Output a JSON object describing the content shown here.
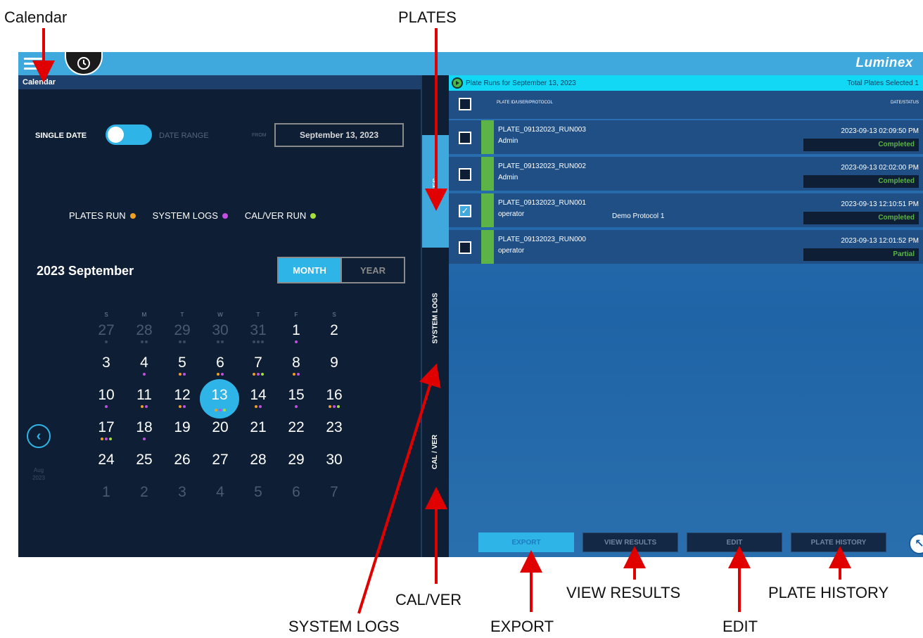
{
  "annotations": {
    "calendar": "Calendar",
    "plates": "PLATES",
    "cal_ver": "CAL/VER",
    "system_logs": "SYSTEM LOGS",
    "export": "EXPORT",
    "view_results": "VIEW RESULTS",
    "edit": "EDIT",
    "plate_history": "PLATE HISTORY"
  },
  "topbar": {
    "brand": "Luminex",
    "menu_icon": "hamburger-icon",
    "history_icon": "history-clock-icon"
  },
  "calendar": {
    "header": "Calendar",
    "single_date_label": "SINGLE DATE",
    "date_range_label": "DATE RANGE",
    "from_label": "FROM",
    "selected_date": "September 13, 2023",
    "legend": [
      {
        "label": "PLATES RUN",
        "color": "#f0a020"
      },
      {
        "label": "SYSTEM LOGS",
        "color": "#c24fe0"
      },
      {
        "label": "CAL/VER RUN",
        "color": "#a6e03a"
      }
    ],
    "month_title": "2023 September",
    "month_button": "MONTH",
    "year_button": "YEAR",
    "weekdays": [
      "S",
      "M",
      "T",
      "W",
      "T",
      "F",
      "S"
    ],
    "prev_label_line1": "Aug",
    "prev_label_line2": "2023",
    "days": [
      {
        "n": "27",
        "m": true,
        "dots": [
          "#3a4a60"
        ]
      },
      {
        "n": "28",
        "m": true,
        "dots": [
          "#3a4a60",
          "#3a4a60"
        ]
      },
      {
        "n": "29",
        "m": true,
        "dots": [
          "#3a4a60",
          "#3a4a60"
        ]
      },
      {
        "n": "30",
        "m": true,
        "dots": [
          "#3a4a60",
          "#3a4a60"
        ]
      },
      {
        "n": "31",
        "m": true,
        "dots": [
          "#3a4a60",
          "#3a4a60",
          "#3a4a60"
        ]
      },
      {
        "n": "1",
        "dots": [
          "#c24fe0"
        ]
      },
      {
        "n": "2",
        "dots": []
      },
      {
        "n": "3",
        "dots": []
      },
      {
        "n": "4",
        "dots": [
          "#c24fe0"
        ]
      },
      {
        "n": "5",
        "dots": [
          "#f0a020",
          "#c24fe0"
        ]
      },
      {
        "n": "6",
        "dots": [
          "#f0a020",
          "#c24fe0"
        ]
      },
      {
        "n": "7",
        "dots": [
          "#f0a020",
          "#c24fe0",
          "#a6e03a"
        ]
      },
      {
        "n": "8",
        "dots": [
          "#f0a020",
          "#c24fe0"
        ]
      },
      {
        "n": "9",
        "dots": []
      },
      {
        "n": "10",
        "dots": [
          "#c24fe0"
        ]
      },
      {
        "n": "11",
        "dots": [
          "#f0a020",
          "#c24fe0"
        ]
      },
      {
        "n": "12",
        "dots": [
          "#f0a020",
          "#c24fe0"
        ]
      },
      {
        "n": "13",
        "sel": true,
        "dots": [
          "#f0a020",
          "#c24fe0",
          "#a6e03a"
        ]
      },
      {
        "n": "14",
        "dots": [
          "#f0a020",
          "#c24fe0"
        ]
      },
      {
        "n": "15",
        "dots": [
          "#c24fe0"
        ]
      },
      {
        "n": "16",
        "dots": [
          "#f0a020",
          "#c24fe0",
          "#a6e03a"
        ]
      },
      {
        "n": "17",
        "dots": [
          "#f0a020",
          "#c24fe0",
          "#a6e03a"
        ]
      },
      {
        "n": "18",
        "dots": [
          "#c24fe0"
        ]
      },
      {
        "n": "19",
        "dots": []
      },
      {
        "n": "20",
        "dots": []
      },
      {
        "n": "21",
        "dots": []
      },
      {
        "n": "22",
        "dots": []
      },
      {
        "n": "23",
        "dots": []
      },
      {
        "n": "24",
        "dots": []
      },
      {
        "n": "25",
        "dots": []
      },
      {
        "n": "26",
        "dots": []
      },
      {
        "n": "27",
        "dots": []
      },
      {
        "n": "28",
        "dots": []
      },
      {
        "n": "29",
        "dots": []
      },
      {
        "n": "30",
        "dots": []
      },
      {
        "n": "1",
        "m": true,
        "dots": []
      },
      {
        "n": "2",
        "m": true,
        "dots": []
      },
      {
        "n": "3",
        "m": true,
        "dots": []
      },
      {
        "n": "4",
        "m": true,
        "dots": []
      },
      {
        "n": "5",
        "m": true,
        "dots": []
      },
      {
        "n": "6",
        "m": true,
        "dots": []
      },
      {
        "n": "7",
        "m": true,
        "dots": []
      }
    ]
  },
  "tabs": {
    "plates": "PLATES",
    "system_logs": "SYSTEM LOGS",
    "cal_ver": "CAL / VER"
  },
  "plates": {
    "header": "Plate Runs for September 13, 2023",
    "selected": "Total Plates Selected 1",
    "col_left": "PLATE ID/USER/PROTOCOL",
    "col_right": "DATE/STATUS",
    "rows": [
      {
        "id": "PLATE_09132023_RUN003",
        "user": "Admin",
        "protocol": "",
        "date": "2023-09-13 02:09:50 PM",
        "status": "Completed",
        "checked": false
      },
      {
        "id": "PLATE_09132023_RUN002",
        "user": "Admin",
        "protocol": "",
        "date": "2023-09-13 02:02:00 PM",
        "status": "Completed",
        "checked": false
      },
      {
        "id": "PLATE_09132023_RUN001",
        "user": "operator",
        "protocol": "Demo Protocol 1",
        "date": "2023-09-13 12:10:51 PM",
        "status": "Completed",
        "checked": true
      },
      {
        "id": "PLATE_09132023_RUN000",
        "user": "operator",
        "protocol": "",
        "date": "2023-09-13 12:01:52 PM",
        "status": "Partial",
        "checked": false
      }
    ]
  },
  "actions": {
    "export": "EXPORT",
    "view_results": "VIEW RESULTS",
    "edit": "EDIT",
    "plate_history": "PLATE HISTORY"
  }
}
